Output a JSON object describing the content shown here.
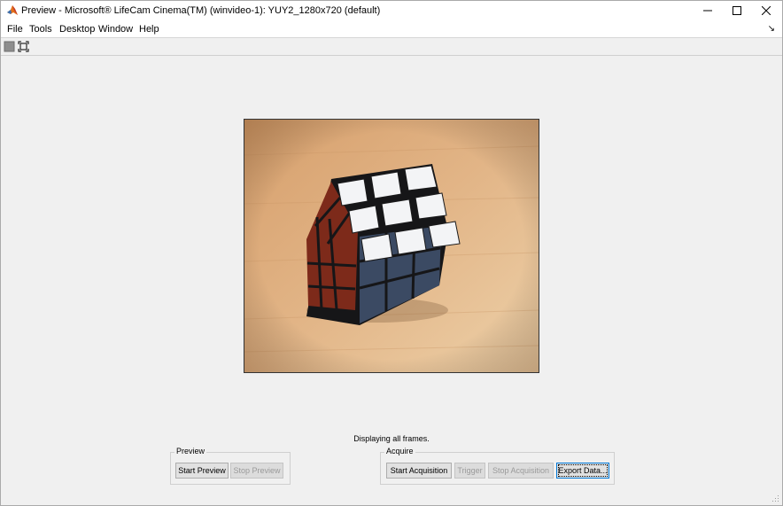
{
  "window": {
    "title": "Preview - Microsoft® LifeCam Cinema(TM) (winvideo-1): YUY2_1280x720 (default)"
  },
  "menu": {
    "items": [
      "File",
      "Tools",
      "Desktop",
      "Window",
      "Help"
    ]
  },
  "icons": {
    "app": "matlab-icon",
    "stop": "stop-icon",
    "fit": "fit-to-window-icon",
    "minimize": "minimize-icon",
    "maximize": "maximize-icon",
    "close": "close-icon"
  },
  "colors": {
    "accent_focus": "#0078d7",
    "background": "#f0f0f0"
  },
  "status": {
    "text": "Displaying all frames."
  },
  "preview_panel": {
    "title": "Preview",
    "start": "Start Preview",
    "stop": "Stop Preview"
  },
  "acquire_panel": {
    "title": "Acquire",
    "start": "Start Acquisition",
    "trigger": "Trigger",
    "stop": "Stop Acquisition",
    "export": "Export Data..."
  }
}
